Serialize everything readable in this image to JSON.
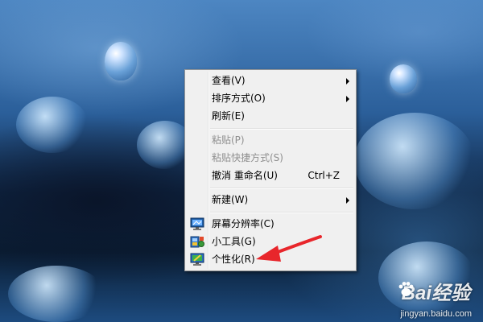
{
  "context_menu": {
    "items": [
      {
        "label": "查看(V)",
        "shortcut": "",
        "submenu": true,
        "disabled": false,
        "icon": ""
      },
      {
        "label": "排序方式(O)",
        "shortcut": "",
        "submenu": true,
        "disabled": false,
        "icon": ""
      },
      {
        "label": "刷新(E)",
        "shortcut": "",
        "submenu": false,
        "disabled": false,
        "icon": ""
      },
      {
        "label": "粘贴(P)",
        "shortcut": "",
        "submenu": false,
        "disabled": true,
        "icon": ""
      },
      {
        "label": "粘贴快捷方式(S)",
        "shortcut": "",
        "submenu": false,
        "disabled": true,
        "icon": ""
      },
      {
        "label": "撤消 重命名(U)",
        "shortcut": "Ctrl+Z",
        "submenu": false,
        "disabled": false,
        "icon": ""
      },
      {
        "label": "新建(W)",
        "shortcut": "",
        "submenu": true,
        "disabled": false,
        "icon": ""
      },
      {
        "label": "屏幕分辨率(C)",
        "shortcut": "",
        "submenu": false,
        "disabled": false,
        "icon": "screen-resolution-icon"
      },
      {
        "label": "小工具(G)",
        "shortcut": "",
        "submenu": false,
        "disabled": false,
        "icon": "gadgets-icon"
      },
      {
        "label": "个性化(R)",
        "shortcut": "",
        "submenu": false,
        "disabled": false,
        "icon": "personalize-icon"
      }
    ]
  },
  "annotation": {
    "color": "#e8262b",
    "target": "个性化(R)"
  },
  "watermark": {
    "brand": "Bai经验",
    "url": "jingyan.baidu.com"
  },
  "colors": {
    "menu_background": "#f0f0f0",
    "menu_border": "#979797",
    "disabled_text": "#8f8f8f",
    "desktop_blue": "#2b5f9a"
  }
}
